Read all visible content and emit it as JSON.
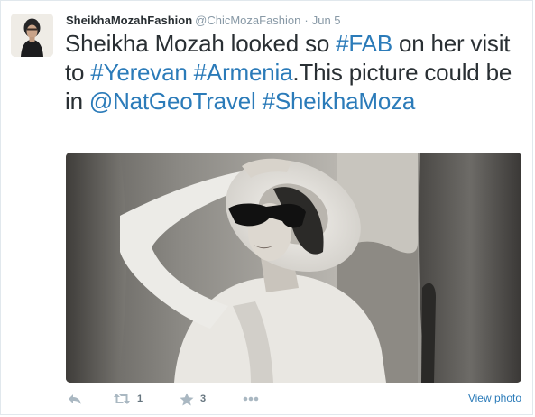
{
  "tweet": {
    "author": {
      "display_name": "SheikhaMozahFashion",
      "handle": "@ChicMozaFashion"
    },
    "separator": "·",
    "timestamp": "Jun 5",
    "text": {
      "part1": "Sheikha Mozah looked so ",
      "hashtag_fab": "#FAB",
      "part2": " on her visit to ",
      "hashtag_yerevan": "#Yerevan",
      "space1": " ",
      "hashtag_armenia": "#Armenia",
      "part3": ".This picture could be in ",
      "mention_natgeo": "@NatGeoTravel",
      "space2": " ",
      "hashtag_sheikhamoza": "#SheikhaMoza"
    },
    "actions": {
      "reply_icon": "reply-icon",
      "retweet_icon": "retweet-icon",
      "retweet_count": "1",
      "favorite_icon": "star-icon",
      "favorite_count": "3",
      "more_icon": "ellipsis-icon"
    },
    "view_photo_label": "View photo"
  },
  "colors": {
    "link": "#2b7bb9",
    "text": "#292f33",
    "muted": "#8899a6",
    "border": "#e1e8ed"
  }
}
